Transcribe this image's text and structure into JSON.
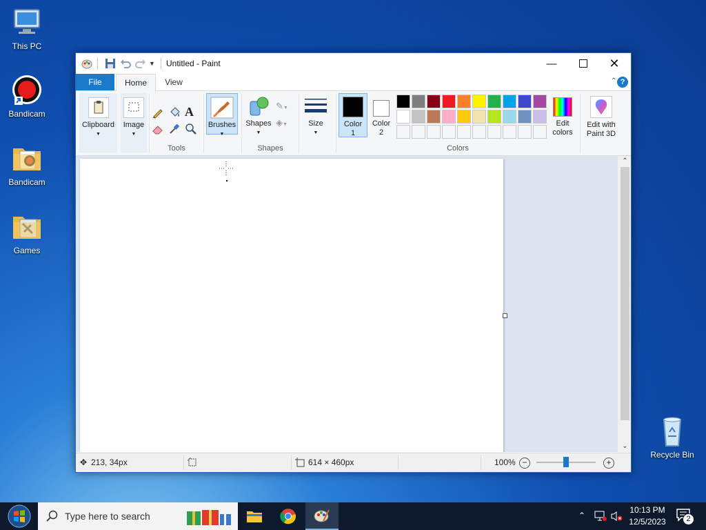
{
  "desktop": {
    "icons": [
      {
        "label": "This PC",
        "icon": "computer-icon"
      },
      {
        "label": "Bandicam",
        "icon": "bandicam-record-icon"
      },
      {
        "label": "Bandicam",
        "icon": "folder-icon"
      },
      {
        "label": "Games",
        "icon": "folder-icon"
      },
      {
        "label": "Recycle Bin",
        "icon": "recycle-bin-icon"
      }
    ]
  },
  "window": {
    "title": "Untitled - Paint",
    "tabs": {
      "file": "File",
      "home": "Home",
      "view": "View"
    },
    "ribbon": {
      "clipboard": "Clipboard",
      "image": "Image",
      "tools_group": "Tools",
      "brushes": "Brushes",
      "shapes": "Shapes",
      "shapes_group": "Shapes",
      "size": "Size",
      "color1": [
        "Color",
        "1"
      ],
      "color2": [
        "Color",
        "2"
      ],
      "colors_group": "Colors",
      "edit_colors": [
        "Edit",
        "colors"
      ],
      "edit_paint3d": [
        "Edit with",
        "Paint 3D"
      ]
    },
    "palette_row1": [
      "#000000",
      "#7f7f7f",
      "#880015",
      "#ed1c24",
      "#ff7f27",
      "#fff200",
      "#22b14c",
      "#00a2e8",
      "#3f48cc",
      "#a349a4"
    ],
    "palette_row2": [
      "#ffffff",
      "#c3c3c3",
      "#b97a57",
      "#ffaec9",
      "#ffc90e",
      "#efe4b0",
      "#b5e61d",
      "#99d9ea",
      "#7092be",
      "#c8bfe7"
    ],
    "color1_value": "#000000",
    "color2_value": "#ffffff",
    "status": {
      "cursor_pos": "213, 34px",
      "canvas_size": "614 × 460px",
      "zoom": "100%"
    }
  },
  "taskbar": {
    "search_placeholder": "Type here to search",
    "time": "10:13 PM",
    "date": "12/5/2023",
    "notification_count": "2"
  }
}
